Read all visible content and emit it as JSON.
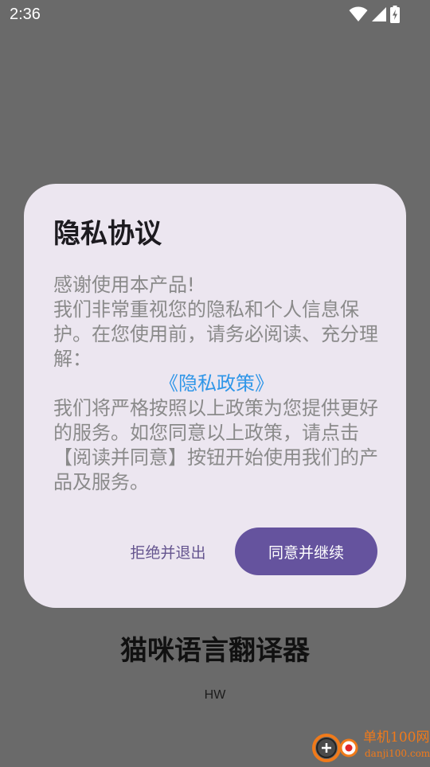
{
  "status_bar": {
    "time": "2:36",
    "icons": [
      "wifi-icon",
      "cellular-signal-icon",
      "battery-charging-icon"
    ]
  },
  "app": {
    "title": "猫咪语言翻译器",
    "subtitle": "HW"
  },
  "dialog": {
    "title": "隐私协议",
    "greeting": "感谢使用本产品!",
    "intro": "我们非常重视您的隐私和个人信息保护。在您使用前，请务必阅读、充分理解：",
    "policy_link": "《隐私政策》",
    "outro": "我们将严格按照以上政策为您提供更好的服务。如您同意以上政策，请点击【阅读并同意】按钮开始使用我们的产品及服务。",
    "decline_label": "拒绝并退出",
    "accept_label": "同意并继续"
  },
  "watermark": {
    "name": "单机100网",
    "url": "danji100.com"
  },
  "colors": {
    "scrim_background": "#6a6a6a",
    "dialog_background": "#ece6f0",
    "title_text": "#1d1b20",
    "body_text": "#8a8a8a",
    "link": "#2f96e8",
    "primary_button": "#65539e",
    "text_button": "#65558f",
    "watermark": "#f07a1a"
  }
}
